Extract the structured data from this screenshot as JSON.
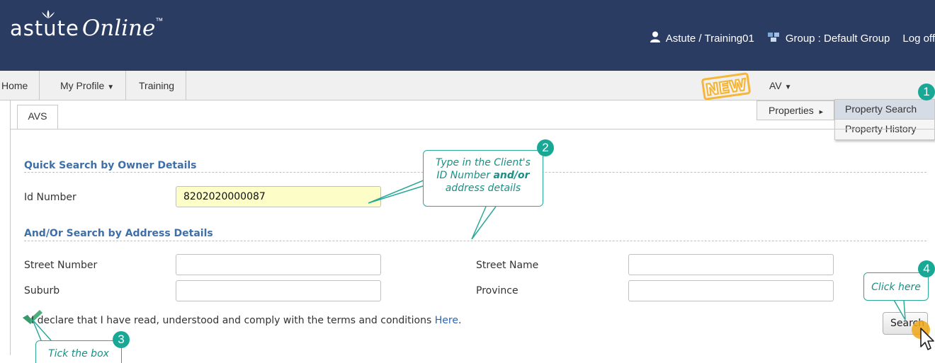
{
  "header": {
    "logo_main": "astute",
    "logo_script": "Online",
    "logo_tm": "™",
    "user": "Astute / Training01",
    "group": "Group : Default Group",
    "logoff": "Log off"
  },
  "nav": {
    "home": "Home",
    "my_profile": "My Profile",
    "training": "Training",
    "new_badge": "NEW",
    "av": "AV",
    "caret": "▼"
  },
  "dropdown": {
    "properties": "Properties",
    "arrow": "►",
    "items": [
      "Property Search",
      "Property History"
    ]
  },
  "tabs": [
    "AVS"
  ],
  "form": {
    "section_owner": "Quick Search by Owner Details",
    "id_label": "Id Number",
    "id_value": "8202020000087",
    "section_address": "And/Or Search by Address Details",
    "street_number_label": "Street Number",
    "street_name_label": "Street Name",
    "suburb_label": "Suburb",
    "province_label": "Province",
    "declare_text": "I declare that I have read, understood and comply with the terms and conditions",
    "declare_link": "Here",
    "declare_end": ".",
    "search_button": "Search"
  },
  "callouts": {
    "step1": "1",
    "step2": "2",
    "step3": "3",
    "step4": "4",
    "c2_line1": "Type in the Client's",
    "c2_line2a": "ID Number ",
    "c2_line2b": "and/or",
    "c2_line3": "address details",
    "c3": "Tick the box",
    "c4": "Click here"
  },
  "colors": {
    "header_bg": "#2b3c63",
    "accent_teal": "#1aa896",
    "section_blue": "#3e6fa8",
    "new_badge": "#f5b63a"
  }
}
